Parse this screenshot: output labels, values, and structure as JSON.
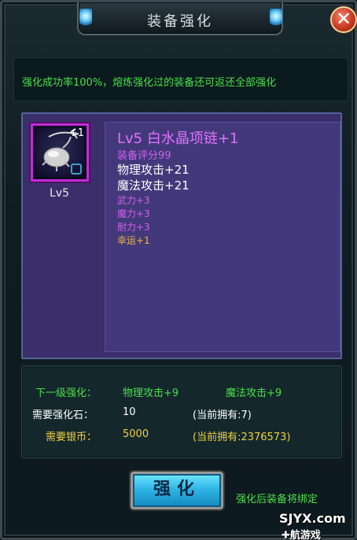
{
  "window": {
    "title": "装备强化",
    "close_label": "✕"
  },
  "info": {
    "text": "强化成功率100%，熔炼强化过的装备还可返还全部强化"
  },
  "item": {
    "plus_badge": "+1",
    "level_label": "Lv5",
    "name": "Lv5 白水晶项链+1",
    "score": "装备评分99",
    "stats": {
      "physical": "物理攻击+21",
      "magic": "魔法攻击+21",
      "wu": "武力+3",
      "mo": "魔力+3",
      "nai": "耐力+3",
      "luck": "幸运+1"
    }
  },
  "requirements": {
    "next_label": "下一级强化：",
    "next_phys": "物理攻击+9",
    "next_magic": "魔法攻击+9",
    "stone_label": "需要强化石：",
    "stone_value": "10",
    "stone_owned": "(当前拥有:7)",
    "silver_label": "需要银币：",
    "silver_value": "5000",
    "silver_owned": "(当前拥有:2376573)"
  },
  "actions": {
    "enhance_label": "强化",
    "bind_note": "强化后装备将绑定"
  },
  "watermark": {
    "line1": "SJYX.com",
    "line2": "✚航游戏"
  },
  "colors": {
    "accent_green": "#48e048",
    "item_purple": "#e070ff",
    "button_blue": "#2fb6e6"
  },
  "icons": [
    "crystal-necklace-icon",
    "lock-icon",
    "close-icon",
    "gem-ornament-icon"
  ]
}
